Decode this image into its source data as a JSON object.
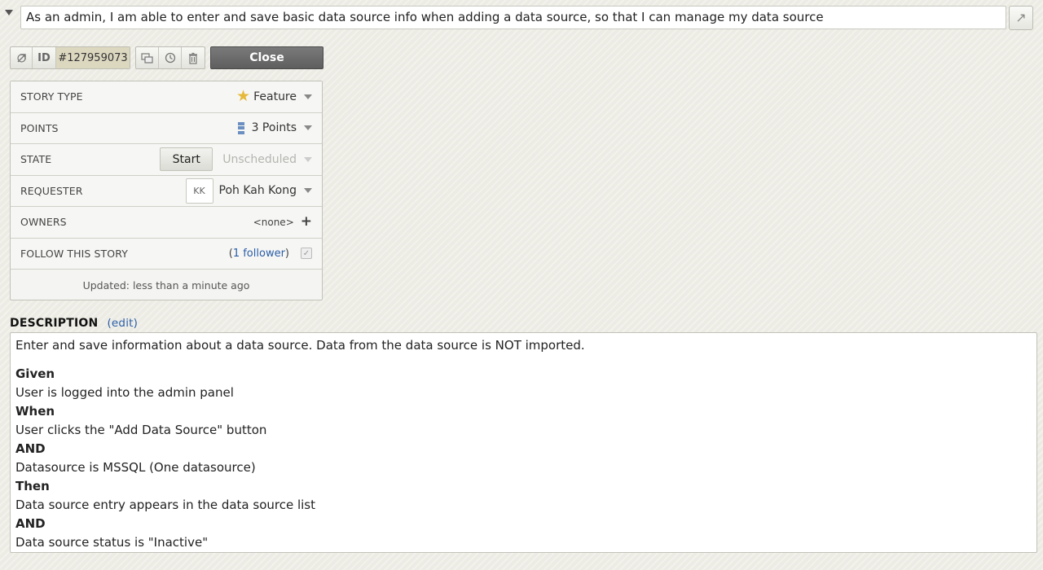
{
  "story": {
    "title": "As an admin, I am able to enter and save basic data source info when adding a data source, so that I can manage my data source"
  },
  "toolbar": {
    "id_label": "ID",
    "id_value": "#127959073",
    "close_label": "Close"
  },
  "fields": {
    "story_type": {
      "label": "STORY TYPE",
      "value": "Feature",
      "icon": "star-icon"
    },
    "points": {
      "label": "POINTS",
      "value": "3 Points",
      "icon": "points-icon"
    },
    "state": {
      "label": "STATE",
      "button": "Start",
      "value": "Unscheduled"
    },
    "requester": {
      "label": "REQUESTER",
      "initials": "KK",
      "value": "Poh Kah Kong"
    },
    "owners": {
      "label": "OWNERS",
      "value": "<none>"
    },
    "follow": {
      "label": "FOLLOW THIS STORY",
      "open": "(",
      "link": "1 follower",
      "close": ")"
    },
    "updated": "Updated: less than a minute ago"
  },
  "description": {
    "header": "DESCRIPTION",
    "edit": "(edit)",
    "intro": "Enter and save information about a data source. Data from the data source is NOT imported.",
    "lines": [
      {
        "text": "Given",
        "bold": true
      },
      {
        "text": "User is logged into the admin panel",
        "bold": false
      },
      {
        "text": "When",
        "bold": true
      },
      {
        "text": "User clicks the \"Add Data Source\" button",
        "bold": false
      },
      {
        "text": "AND",
        "bold": true
      },
      {
        "text": "Datasource is MSSQL (One datasource)",
        "bold": false
      },
      {
        "text": "Then",
        "bold": true
      },
      {
        "text": "Data source entry appears in the data source list",
        "bold": false
      },
      {
        "text": "AND",
        "bold": true
      },
      {
        "text": "Data source status is \"Inactive\"",
        "bold": false
      }
    ]
  }
}
